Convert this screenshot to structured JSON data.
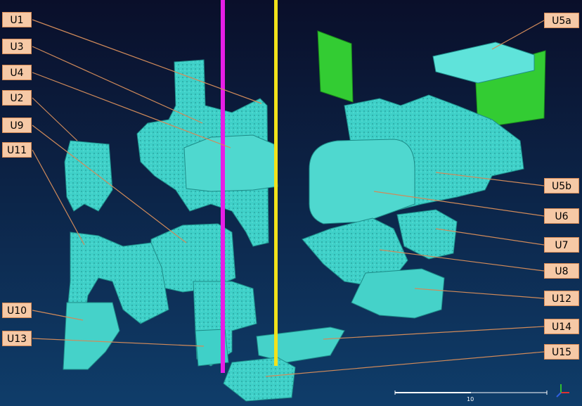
{
  "labels": {
    "U1": "U1",
    "U3": "U3",
    "U4": "U4",
    "U2": "U2",
    "U9": "U9",
    "U11": "U11",
    "U10": "U10",
    "U13": "U13",
    "U5a": "U5a",
    "U5b": "U5b",
    "U6": "U6",
    "U7": "U7",
    "U8": "U8",
    "U12": "U12",
    "U14": "U14",
    "U15": "U15"
  },
  "scale_bar": {
    "label": "10"
  },
  "colors": {
    "background_top": "#0a0f2a",
    "background_bottom": "#0f3d6a",
    "model": "#3fd0c8",
    "model_dark": "#1e8c88",
    "highlight_green": "#33cc33",
    "pole_magenta": "#e61ee6",
    "pole_yellow": "#f2e21a",
    "leader_line": "#d08a5a",
    "label_fill": "#f6c9a6"
  },
  "icons": {
    "axis_gizmo": "xyz-axis-icon"
  }
}
